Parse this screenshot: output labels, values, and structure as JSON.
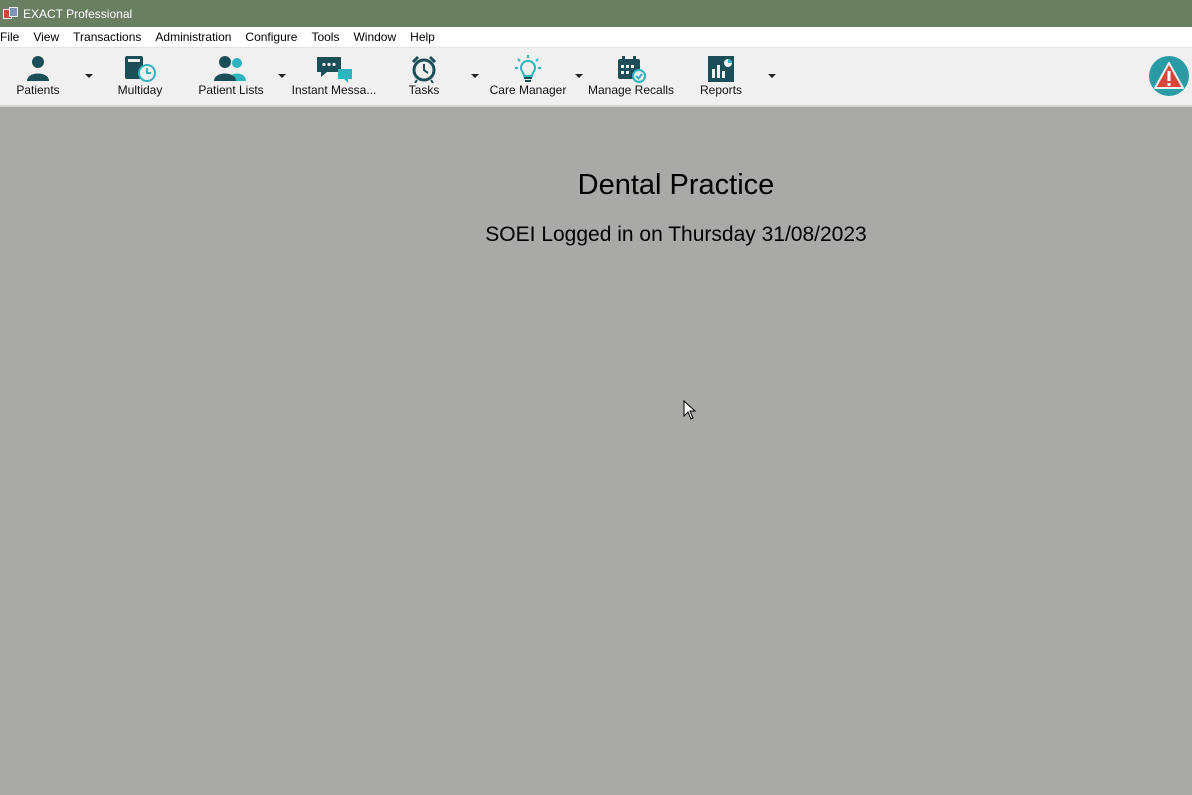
{
  "window": {
    "title": "EXACT Professional"
  },
  "menu": [
    "File",
    "View",
    "Transactions",
    "Administration",
    "Configure",
    "Tools",
    "Window",
    "Help"
  ],
  "toolbar": {
    "patients": "Patients",
    "multiday": "Multiday",
    "patient_lists": "Patient Lists",
    "instant_messages": "Instant Messa...",
    "tasks": "Tasks",
    "care_manager": "Care Manager",
    "manage_recalls": "Manage Recalls",
    "reports": "Reports"
  },
  "icons": {
    "patients": "person-icon",
    "multiday": "book-clock-icon",
    "patient_lists": "people-icon",
    "instant_messages": "chat-bubbles-icon",
    "tasks": "alarm-clock-icon",
    "care_manager": "lightbulb-icon",
    "manage_recalls": "calendar-check-icon",
    "reports": "report-chart-icon",
    "alert": "warning-triangle-icon"
  },
  "colors": {
    "titlebar": "#6a7f62",
    "icon_dark": "#1b4e57",
    "icon_accent": "#2fb3bf",
    "alert_bg": "#2a9ba4",
    "alert_triangle": "#d9453a",
    "workspace": "#a9a9a7"
  },
  "main": {
    "practice_name": "Dental Practice",
    "login_status": "SOEI Logged in on Thursday 31/08/2023"
  }
}
